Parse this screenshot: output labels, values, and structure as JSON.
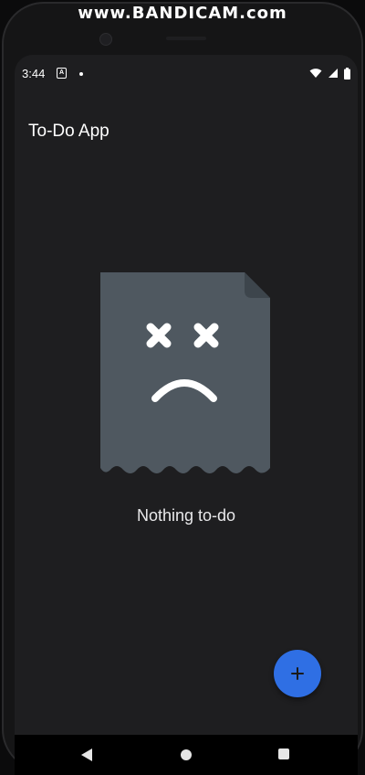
{
  "watermark": "www.BANDICAM.com",
  "status_bar": {
    "time": "3:44",
    "notification_icon_letter": "A",
    "icons": [
      "a-notification-icon",
      "dot-icon",
      "wifi-icon",
      "signal-icon",
      "battery-icon"
    ]
  },
  "app_bar": {
    "title": "To-Do App"
  },
  "empty_state": {
    "icon": "sad-document-icon",
    "message": "Nothing to-do"
  },
  "fab": {
    "icon": "plus-icon",
    "color": "#2f6fe4"
  },
  "navigation": {
    "buttons": [
      "back",
      "home",
      "recents"
    ]
  },
  "colors": {
    "background": "#1e1e20",
    "illustration": "#4f5860",
    "text": "#ffffff",
    "accent": "#2f6fe4"
  }
}
